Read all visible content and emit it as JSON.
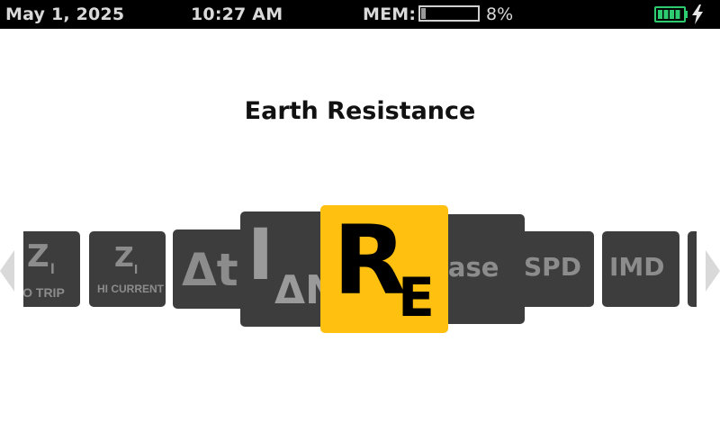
{
  "status_bar": {
    "date": "May 1, 2025",
    "time": "10:27 AM",
    "mem_label": "MEM:",
    "mem_percent_text": "8%",
    "mem_fill_fraction": 0.08,
    "battery_level": 1.0,
    "battery_color": "#2ecc71"
  },
  "page": {
    "title": "Earth Resistance"
  },
  "carousel": {
    "accent_color": "#ffc010",
    "tile_color": "#3d3d3d",
    "items": [
      {
        "symbol": "Z",
        "subscript": "I",
        "caption": "NO TRIP"
      },
      {
        "symbol": "Z",
        "subscript": "I",
        "caption": "HI CURRENT"
      },
      {
        "symbol": "Δt"
      },
      {
        "symbol": "I",
        "subscript": "ΔN"
      },
      {
        "symbol": "R",
        "subscript": "E",
        "selected": true
      },
      {
        "label": "Phase"
      },
      {
        "label": "SPD"
      },
      {
        "label": "IMD"
      }
    ]
  },
  "icons": {
    "left_arrow": "chevron-left-icon",
    "right_arrow": "chevron-right-icon",
    "battery": "battery-icon",
    "charging": "lightning-bolt-icon"
  }
}
